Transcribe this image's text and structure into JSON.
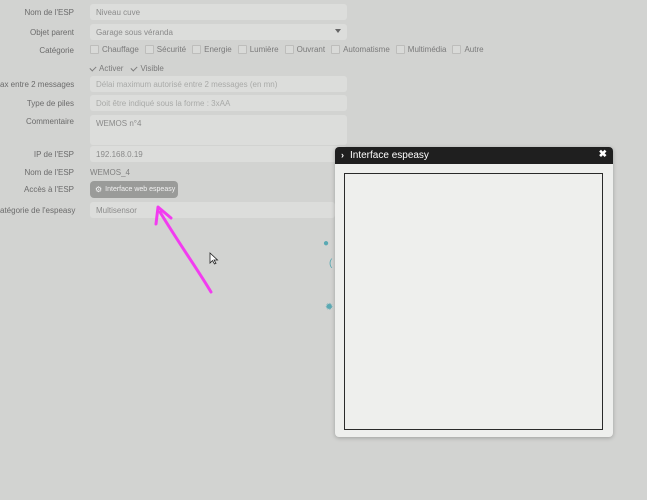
{
  "form": {
    "fields": [
      {
        "label": "Nom de l'ESP",
        "value": "Niveau cuve"
      },
      {
        "label": "Objet parent",
        "value": "Garage sous véranda"
      },
      {
        "label": "Catégorie"
      },
      {
        "label": "ax entre 2 messages",
        "placeholder": "Délai maximum autorisé entre 2 messages (en mn)"
      },
      {
        "label": "Type de piles",
        "placeholder": "Doit être indiqué sous la forme : 3xAA"
      },
      {
        "label": "Commentaire",
        "value": "WEMOS n°4"
      },
      {
        "label": "IP de l'ESP",
        "value": "192.168.0.19"
      },
      {
        "label": "Nom de l'ESP",
        "value": "WEMOS_4"
      },
      {
        "label": "Accès à l'ESP"
      },
      {
        "label": "atégorie de l'espeasy",
        "value": "Multisensor"
      }
    ],
    "categories": [
      "Chauffage",
      "Sécurité",
      "Energie",
      "Lumière",
      "Ouvrant",
      "Automatisme",
      "Multimédia",
      "Autre"
    ],
    "flags": [
      "Activer",
      "Visible"
    ],
    "access_button": "Interface web espeasy",
    "colors": {
      "annotation_arrow": "#f23cf0",
      "accent": "#5aa9b3"
    }
  },
  "modal": {
    "title": "Interface espeasy",
    "close_icon": "close-icon"
  }
}
